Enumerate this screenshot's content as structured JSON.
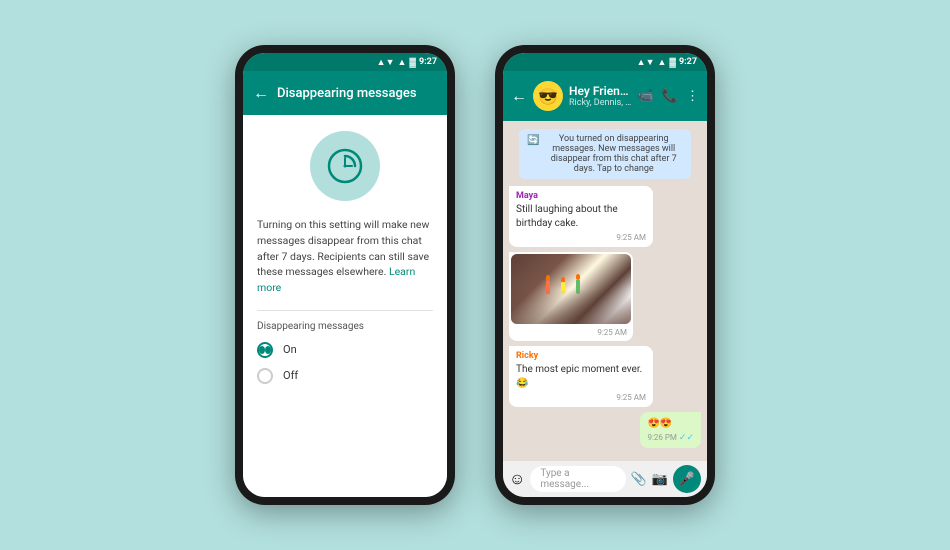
{
  "background_color": "#b2e0de",
  "phone1": {
    "status_bar": {
      "time": "9:27",
      "signal": "▲▼",
      "wifi": "▲",
      "battery": "▓"
    },
    "header": {
      "back_label": "←",
      "title": "Disappearing messages"
    },
    "description": "Turning on this setting will make new messages disappear from this chat after 7 days. Recipients can still save these messages elsewhere.",
    "learn_more_label": "Learn more",
    "section_label": "Disappearing messages",
    "options": [
      {
        "id": "on",
        "label": "On",
        "selected": true
      },
      {
        "id": "off",
        "label": "Off",
        "selected": false
      }
    ]
  },
  "phone2": {
    "status_bar": {
      "time": "9:27"
    },
    "header": {
      "back_label": "←",
      "group_name": "Hey Friends",
      "members": "Ricky, Dennis, Maya...",
      "avatar_emoji": "😎"
    },
    "system_message": "You turned on disappearing messages. New messages will disappear from this chat after 7 days. Tap to change",
    "messages": [
      {
        "type": "incoming",
        "sender": "Maya",
        "sender_color": "maya",
        "text": "Still laughing about the birthday cake.",
        "time": "9:25 AM"
      },
      {
        "type": "image",
        "time": "9:25 AM"
      },
      {
        "type": "incoming",
        "sender": "Ricky",
        "sender_color": "ricky",
        "text": "The most epic moment ever.😂",
        "time": "9:25 AM"
      },
      {
        "type": "outgoing",
        "text": "😍😍",
        "time": "9:26 PM",
        "ticks": "✓"
      }
    ],
    "input": {
      "placeholder": "Type a message...",
      "emoji_icon": "☺",
      "mic_icon": "🎤"
    }
  }
}
